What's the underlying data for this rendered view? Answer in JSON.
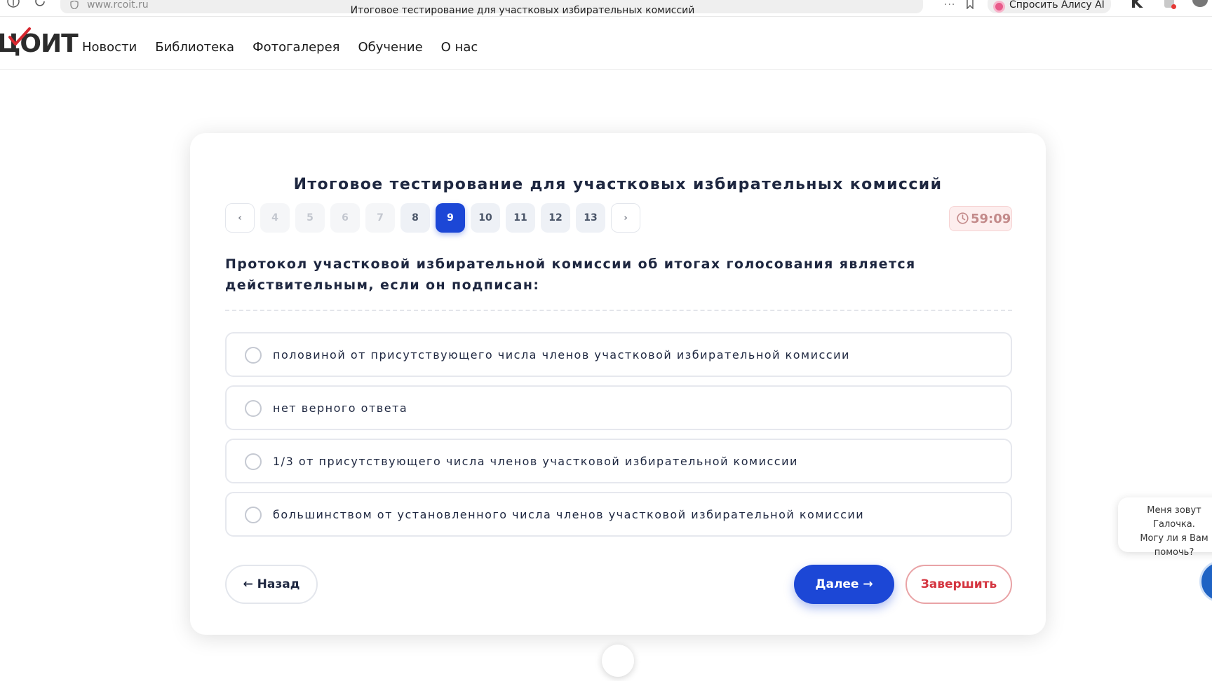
{
  "browser": {
    "url": "www.rcoit.ru",
    "tab_title": "Итоговое тестирование для участковых избирательных комиссий",
    "alice_label": "Спросить Алису AI",
    "more_label": "···"
  },
  "site": {
    "logo_text": "ЦОИТ",
    "nav": [
      "Новости",
      "Библиотека",
      "Фотогалерея",
      "Обучение",
      "О нас"
    ]
  },
  "quiz": {
    "title": "Итоговое тестирование для участковых избирательных комиссий",
    "pager": {
      "prev": "‹",
      "next": "›",
      "pages": [
        "4",
        "5",
        "6",
        "7",
        "8",
        "9",
        "10",
        "11",
        "12",
        "13"
      ],
      "current": "9"
    },
    "timer": "59:09",
    "question": "Протокол участковой избирательной комиссии об итогах голосования является действительным, если он подписан:",
    "options": [
      "половиной от присутствующего числа членов участковой избирательной комиссии",
      "нет верного ответа",
      "1/3 от присутствующего числа членов участковой избирательной комиссии",
      "большинством от установленного числа членов участковой избирательной комиссии"
    ],
    "back_label": "← Назад",
    "next_label": "Далее →",
    "finish_label": "Завершить"
  },
  "chat": {
    "message": "Меня зовут Галочка.\nМогу ли я Вам\nпомочь?"
  },
  "colors": {
    "accent": "#1c47d6",
    "danger": "#d4343f",
    "text": "#1e2740"
  }
}
